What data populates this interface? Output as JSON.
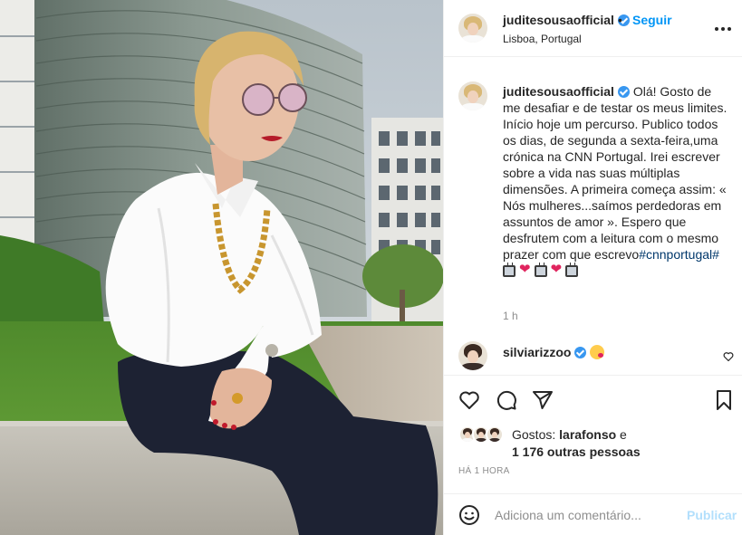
{
  "post": {
    "username": "juditesousaofficial",
    "follow_label": "Seguir",
    "separator": "•",
    "location": "Lisboa, Portugal",
    "more_icon": "more-horizontal-icon"
  },
  "caption": {
    "username": "juditesousaofficial",
    "text": "Olá! Gosto de me desafiar e de testar os meus limites. Início hoje um percurso. Publico todos os dias, de segunda a sexta-feira,uma crónica na CNN Portugal. Irei escrever sobre a vida nas suas múltiplas dimensões. A primeira começa assim: « Nós mulheres...saímos perdedoras em assuntos de amor ». Espero que desfrutem com a leitura com o mesmo prazer com que escrevo",
    "hashtag": "#cnnportugal#",
    "time": "1 h"
  },
  "comments": [
    {
      "username": "silviarizzoo",
      "emoji": "face-blowing-kiss"
    }
  ],
  "actions": {
    "icons": [
      "heart-icon",
      "comment-icon",
      "share-icon",
      "bookmark-icon"
    ]
  },
  "likes": {
    "prefix": "Gostos: ",
    "first_user": "larafonso",
    "conjunction": " e",
    "others": "1 176 outras pessoas"
  },
  "timestamp": "HÁ 1 HORA",
  "composer": {
    "placeholder": "Adiciona um comentário...",
    "publish_label": "Publicar"
  },
  "colors": {
    "accent": "#0095f6",
    "verified": "#3897f0",
    "publish_disabled": "#b2dffc",
    "heart": "#e0245e"
  }
}
